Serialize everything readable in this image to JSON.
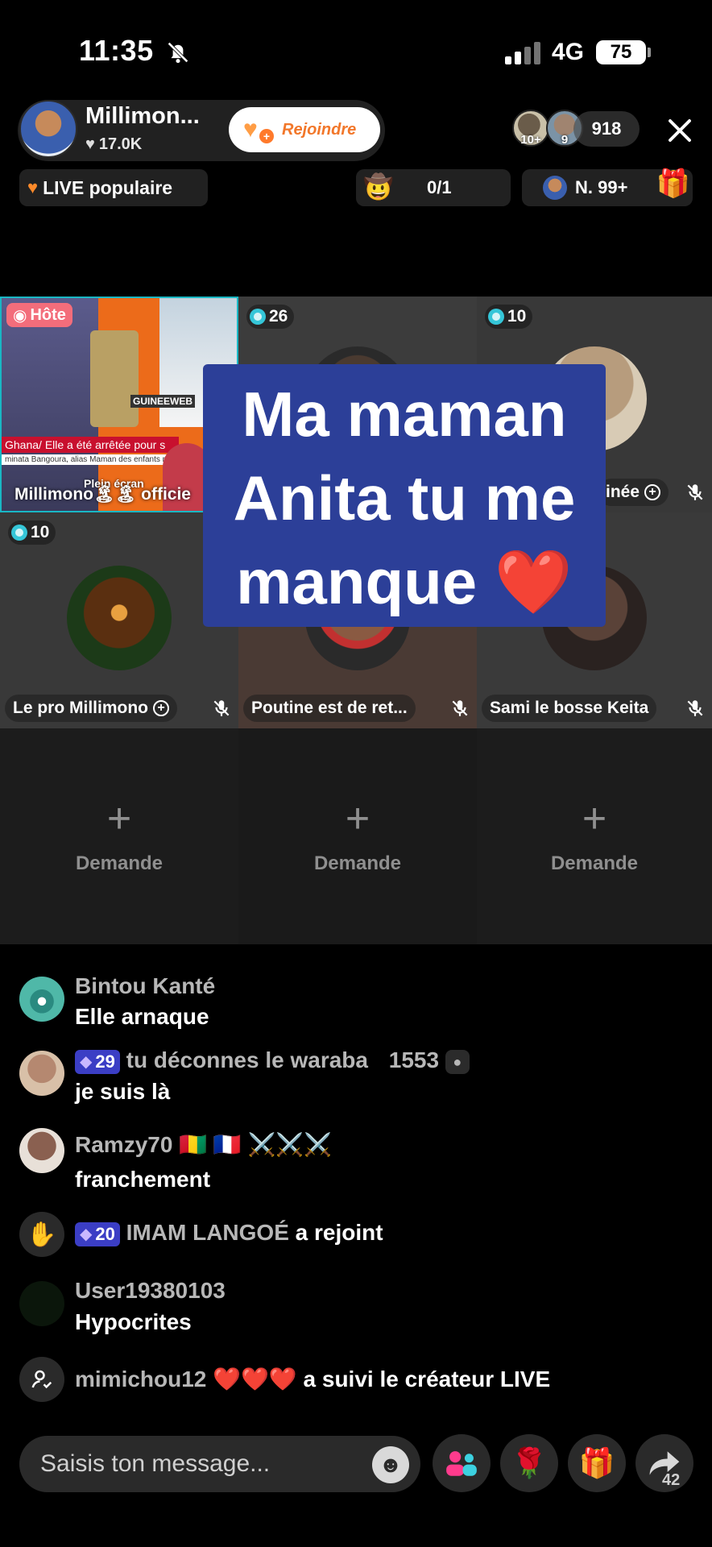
{
  "status": {
    "time": "11:35",
    "network": "4G",
    "battery": "75"
  },
  "host": {
    "name": "Millimon...",
    "likes": "17.0K",
    "join_label": "Rejoindre"
  },
  "viewers": {
    "badge1": "10+",
    "badge2": "9",
    "count": "918"
  },
  "header2": {
    "popular_label": "LIVE populaire",
    "hat_count": "0/1",
    "rank_label": "N. 99+"
  },
  "grid": {
    "host_video": {
      "badge": "Hôte",
      "name": "Millimono🏝🏝 officie",
      "fullscreen": "Plein écran",
      "caption_line1": "Ghana/ Elle a été arrêtée pour s",
      "caption_line2": "minata Bangoura, alias Maman des enfants refu",
      "logo": "GUINEEWEB"
    },
    "guests": [
      {
        "badge": "26",
        "name": ""
      },
      {
        "badge": "10",
        "name": "inée"
      },
      {
        "badge": "10",
        "name": "Le pro Millimono"
      },
      {
        "badge": "",
        "name": "Poutine est de ret..."
      },
      {
        "badge": "",
        "name": "Sami le bosse Keita"
      }
    ],
    "request_label": "Demande"
  },
  "sticker": {
    "line1": "Ma maman",
    "line2": "Anita tu me",
    "line3": "manque ❤️"
  },
  "chat": [
    {
      "name": "Bintou Kanté",
      "message": "Elle arnaque"
    },
    {
      "level": "29",
      "name": "tu déconnes le waraba",
      "extra": "1553",
      "message": "je suis là"
    },
    {
      "name": "Ramzy70 🇬🇳 🇫🇷 ⚔️⚔️⚔️",
      "message": "franchement"
    },
    {
      "level": "20",
      "name": "IMAM LANGOÉ",
      "message": "a rejoint"
    },
    {
      "name": "User19380103",
      "message": "Hypocrites"
    },
    {
      "name": "mimichou12 ❤️❤️❤️",
      "message": "a suivi le créateur LIVE"
    }
  ],
  "bottom": {
    "placeholder": "Saisis ton message...",
    "share_count": "42"
  },
  "colors": {
    "accent_orange": "#f2772a",
    "host_badge": "#f36d7b",
    "level_badge": "#3b3ec5",
    "sticker_bg": "#2c3f98"
  },
  "icons": [
    "mute-icon",
    "close-icon",
    "hat-icon",
    "gift-icon",
    "mic-off-icon",
    "plus-icon",
    "emoji-icon",
    "invite-icon",
    "rose-icon",
    "share-icon"
  ]
}
